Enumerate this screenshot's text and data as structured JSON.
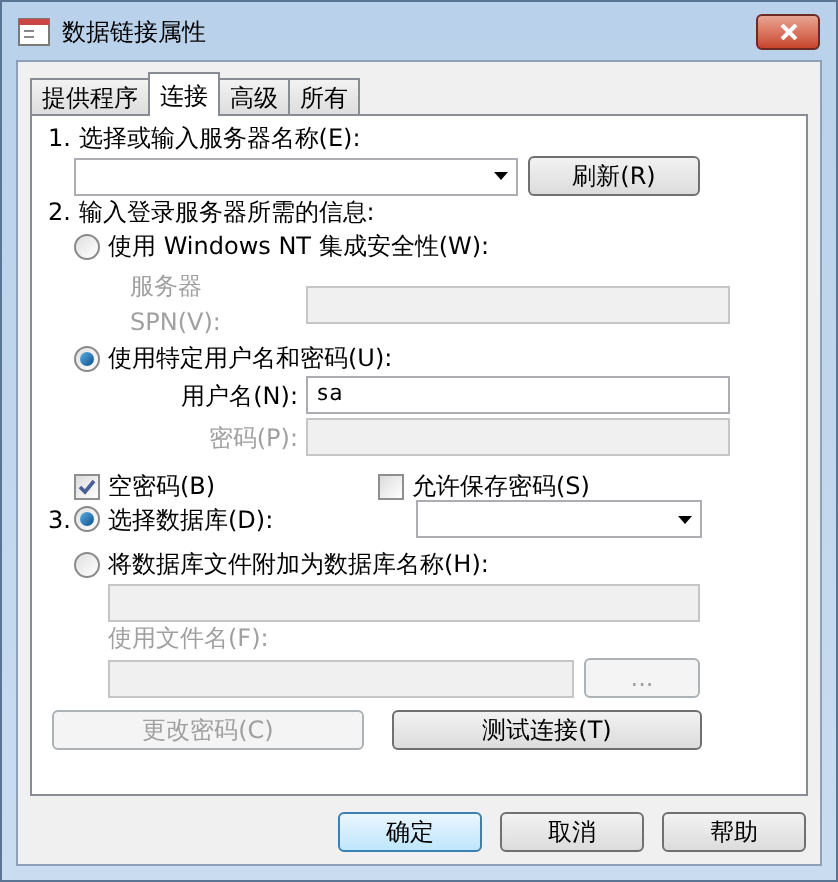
{
  "window": {
    "title": "数据链接属性"
  },
  "tabs": [
    {
      "label": "提供程序",
      "selected": false
    },
    {
      "label": "连接",
      "selected": true
    },
    {
      "label": "高级",
      "selected": false
    },
    {
      "label": "所有",
      "selected": false
    }
  ],
  "step1": {
    "label": "1. 选择或输入服务器名称(E):",
    "refresh_button": {
      "label": "刷新(R)"
    }
  },
  "step2": {
    "label": "2. 输入登录服务器所需的信息:",
    "options": [
      {
        "label": "使用 Windows NT 集成安全性(W):",
        "selected": false
      },
      {
        "label": "使用特定用户名和密码(U):",
        "selected": true
      }
    ],
    "spn": {
      "label": "服务器 SPN(V):",
      "disabled": true
    },
    "username": {
      "label": "用户名(N):",
      "value": "sa",
      "disabled": false
    },
    "password": {
      "label": "密码(P):",
      "disabled": true
    },
    "checkboxes": [
      {
        "label": "空密码(B)",
        "checked": true
      },
      {
        "label": "允许保存密码(S)",
        "checked": false
      }
    ]
  },
  "step3": {
    "number": "3.",
    "options": [
      {
        "label": "选择数据库(D):",
        "selected": true
      },
      {
        "label": "将数据库文件附加为数据库名称(H):",
        "selected": false
      }
    ],
    "attach_field": {
      "disabled": true
    },
    "filename": {
      "label": "使用文件名(F):",
      "disabled": true
    },
    "browse_button": {
      "label": "...",
      "disabled": true
    }
  },
  "actions": [
    {
      "label": "更改密码(C)",
      "disabled": true
    },
    {
      "label": "测试连接(T)",
      "disabled": false
    }
  ],
  "buttons": [
    {
      "label": "确定",
      "default": true
    },
    {
      "label": "取消",
      "default": false
    },
    {
      "label": "帮助",
      "default": false
    }
  ]
}
